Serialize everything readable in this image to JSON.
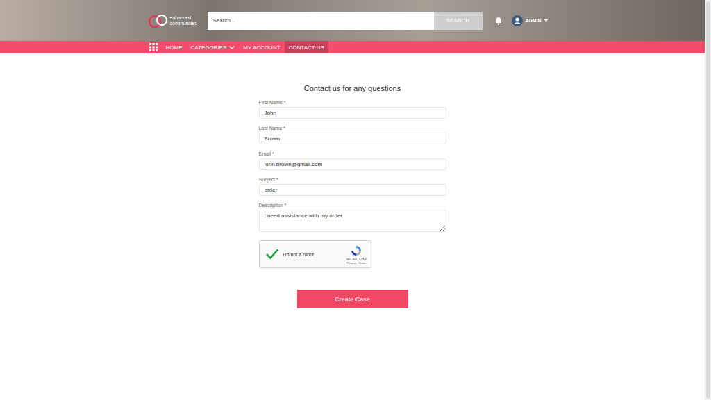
{
  "header": {
    "logo": [
      "enhanced",
      "communities"
    ],
    "search": {
      "placeholder": "Search...",
      "button": "SEARCH"
    },
    "user": {
      "name": "ADMIN"
    }
  },
  "nav": {
    "items": [
      {
        "label": "HOME",
        "selected": false,
        "dropdown": false
      },
      {
        "label": "CATEGORIES",
        "selected": false,
        "dropdown": true
      },
      {
        "label": "MY ACCOUNT",
        "selected": false,
        "dropdown": false
      },
      {
        "label": "CONTACT US",
        "selected": true,
        "dropdown": false
      }
    ]
  },
  "form": {
    "title": "Contact us for any questions",
    "fields": [
      {
        "label": "First Name",
        "required_mark": "*",
        "value": "John",
        "kind": "input"
      },
      {
        "label": "Last Name",
        "required_mark": "*",
        "value": "Brown",
        "kind": "input"
      },
      {
        "label": "Email",
        "required_mark": "*",
        "value": "john.brown@gmail.com",
        "kind": "input"
      },
      {
        "label": "Subject",
        "required_mark": "*",
        "value": "order",
        "kind": "input"
      },
      {
        "label": "Description",
        "required_mark": "*",
        "value": "I need assistance with my order.",
        "kind": "textarea"
      }
    ],
    "captcha": {
      "label": "I'm not a robot",
      "checked": true,
      "brand": "reCAPTCHA",
      "links": "Privacy - Terms"
    },
    "submit": "Create Case"
  }
}
